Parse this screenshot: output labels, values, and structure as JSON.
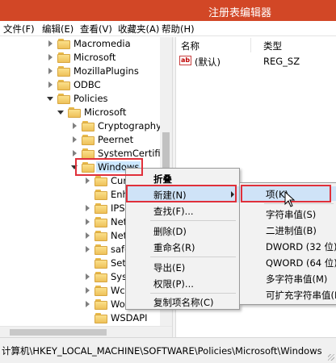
{
  "window": {
    "title": "注册表编辑器"
  },
  "menubar": [
    "文件(F)",
    "编辑(E)",
    "查看(V)",
    "收藏夹(A)",
    "帮助(H)"
  ],
  "tree": {
    "items": [
      {
        "label": "Macromedia",
        "expander": "closed"
      },
      {
        "label": "Microsoft",
        "expander": "closed"
      },
      {
        "label": "MozillaPlugins",
        "expander": "closed"
      },
      {
        "label": "ODBC",
        "expander": "closed"
      },
      {
        "label": "Policies",
        "expander": "open"
      },
      {
        "label": "Microsoft",
        "expander": "open"
      },
      {
        "label": "Cryptography",
        "expander": "closed"
      },
      {
        "label": "Peernet",
        "expander": "closed"
      },
      {
        "label": "SystemCertifica",
        "expander": "closed"
      },
      {
        "label": "Windows",
        "expander": "open",
        "selected": true
      },
      {
        "label": "Curr",
        "expander": "closed"
      },
      {
        "label": "Enha",
        "expander": "none"
      },
      {
        "label": "IPSe",
        "expander": "closed"
      },
      {
        "label": "Netw",
        "expander": "closed"
      },
      {
        "label": "Netw",
        "expander": "closed"
      },
      {
        "label": "safe",
        "expander": "closed"
      },
      {
        "label": "Setti",
        "expander": "none"
      },
      {
        "label": "Syste",
        "expander": "closed"
      },
      {
        "label": "Wcm",
        "expander": "closed"
      },
      {
        "label": "Wor",
        "expander": "closed"
      },
      {
        "label": "WSDAPI",
        "expander": "none"
      }
    ]
  },
  "values": {
    "columns": {
      "name": "名称",
      "type": "类型"
    },
    "rows": [
      {
        "icon": "ab",
        "name": "(默认)",
        "type": "REG_SZ"
      }
    ]
  },
  "context_menu": {
    "items": [
      {
        "label": "折叠",
        "bold": true
      },
      {
        "label": "新建(N)",
        "submenu": true,
        "highlight": true
      },
      {
        "label": "查找(F)..."
      },
      {
        "label": "删除(D)"
      },
      {
        "label": "重命名(R)"
      },
      {
        "label": "导出(E)"
      },
      {
        "label": "权限(P)..."
      },
      {
        "label": "复制项名称(C)"
      }
    ]
  },
  "submenu": {
    "items": [
      {
        "label": "项(K)",
        "highlight": true
      },
      {
        "label": "字符串值(S)"
      },
      {
        "label": "二进制值(B)"
      },
      {
        "label": "DWORD (32 位)值(D)"
      },
      {
        "label": "QWORD (64 位)值(Q)"
      },
      {
        "label": "多字符串值(M)"
      },
      {
        "label": "可扩充字符串值(E)"
      }
    ]
  },
  "statusbar": {
    "path": "计算机\\HKEY_LOCAL_MACHINE\\SOFTWARE\\Policies\\Microsoft\\Windows"
  },
  "colors": {
    "titlebar": "#d24726",
    "highlight": "#cfe3f7",
    "annotation": "#e0303a"
  }
}
